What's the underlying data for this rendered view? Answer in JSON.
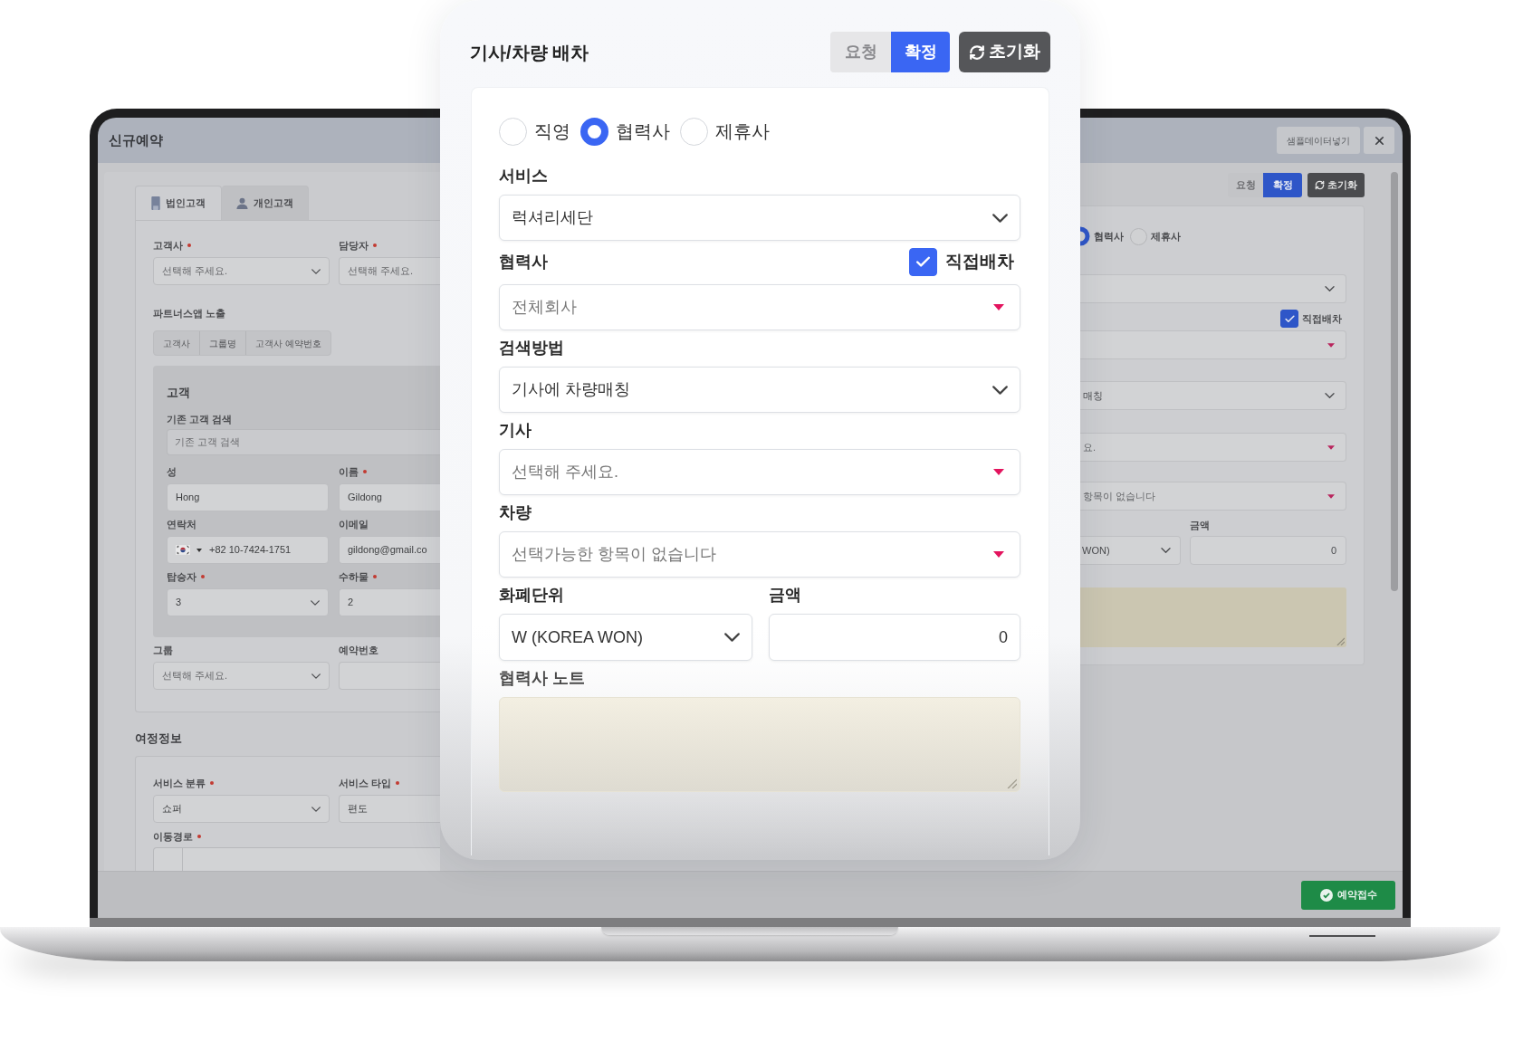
{
  "app_window": {
    "title": "신규예약",
    "header_buttons": [
      {
        "kind": "text",
        "label": "샘플데이터넣기"
      },
      {
        "kind": "close"
      }
    ],
    "customer_tabs": [
      {
        "kind": "corporate",
        "label": "법인고객",
        "selected": true
      },
      {
        "kind": "personal",
        "label": "개인고객",
        "selected": false
      }
    ],
    "top_fields": [
      {
        "label": "고객사",
        "required": true,
        "kind": "select",
        "placeholder": "선택해 주세요."
      },
      {
        "label": "담당자",
        "required": true,
        "kind": "field",
        "placeholder": "선택해 주세요."
      }
    ],
    "partner_app_exposure": {
      "label": "파트너스앱 노출",
      "options": [
        "고객사",
        "그룹명",
        "고객사 예약번호"
      ]
    },
    "customer_panel": {
      "title": "고객",
      "search_label": "기존 고객 검색",
      "search_placeholder": "기존 고객 검색",
      "fields": [
        {
          "label": "성",
          "required": false,
          "kind": "field",
          "value": "Hong"
        },
        {
          "label": "이름",
          "required": true,
          "kind": "field",
          "value": "Gildong"
        },
        {
          "label": "연락처",
          "required": false,
          "kind": "phone",
          "value": "+82 10-7424-1751"
        },
        {
          "label": "이메일",
          "required": false,
          "kind": "field",
          "value": "gildong@gmail.co"
        },
        {
          "label": "탑승자",
          "required": true,
          "kind": "select",
          "value": "3"
        },
        {
          "label": "수하물",
          "required": true,
          "kind": "field",
          "value": "2"
        }
      ]
    },
    "bottom_fields": [
      {
        "label": "그룹",
        "required": false,
        "kind": "select",
        "placeholder": "선택해 주세요."
      },
      {
        "label": "예약번호",
        "required": false,
        "kind": "field"
      }
    ],
    "trip_info": {
      "title": "여정정보",
      "fields": [
        {
          "label": "서비스 분류",
          "required": true,
          "kind": "select",
          "value": "쇼퍼"
        },
        {
          "label": "서비스 타입",
          "required": true,
          "kind": "field",
          "value": "편도"
        }
      ],
      "route_label": "이동경로",
      "route_required": true
    },
    "dispatch_panel": {
      "status_buttons": [
        {
          "label": "요청",
          "selected": false
        },
        {
          "label": "확정",
          "selected": true
        }
      ],
      "reset_button": "초기화",
      "assignment_types": [
        {
          "label": "협력사",
          "selected": true
        },
        {
          "label": "제휴사",
          "selected": false
        }
      ],
      "direct_dispatch": {
        "label": "직접배차",
        "checked": true
      },
      "fields": [
        {
          "kind": "select"
        },
        {
          "kind": "combo"
        },
        {
          "kind": "select",
          "value": "매칭"
        },
        {
          "kind": "combo",
          "placeholder": "요."
        },
        {
          "kind": "combo",
          "placeholder": "항목이 없습니다"
        }
      ],
      "currency": {
        "value": "WON)"
      },
      "amount": {
        "label": "금액",
        "value": "0"
      }
    },
    "footer": {
      "submit_button": "예약접수"
    }
  },
  "dispatch_popup": {
    "title": "기사/차량 배차",
    "status_buttons": [
      {
        "label": "요청",
        "selected": false
      },
      {
        "label": "확정",
        "selected": true
      }
    ],
    "reset_button": "초기화",
    "assignment_types": [
      {
        "label": "직영",
        "selected": false
      },
      {
        "label": "협력사",
        "selected": true
      },
      {
        "label": "제휴사",
        "selected": false
      }
    ],
    "fields": [
      {
        "label": "서비스",
        "kind": "select",
        "value": "럭셔리세단"
      },
      {
        "label": "협력사",
        "kind": "combo",
        "placeholder": "전체회사",
        "checkbox": {
          "label": "직접배차",
          "checked": true
        }
      },
      {
        "label": "검색방법",
        "kind": "select",
        "value": "기사에 차량매칭"
      },
      {
        "label": "기사",
        "kind": "combo",
        "placeholder": "선택해 주세요."
      },
      {
        "label": "차량",
        "kind": "combo",
        "placeholder": "선택가능한 항목이 없습니다"
      }
    ],
    "currency": {
      "label": "화폐단위",
      "value": "W (KOREA WON)"
    },
    "amount": {
      "label": "금액",
      "value": "0"
    },
    "note": {
      "label": "협력사 노트"
    }
  }
}
